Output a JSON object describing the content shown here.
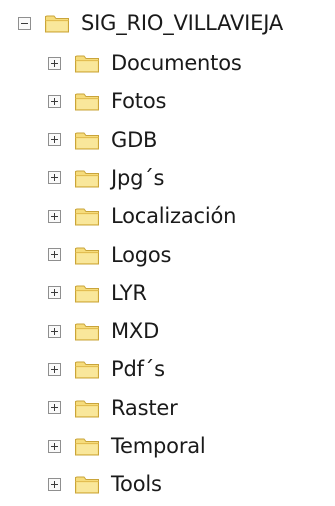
{
  "tree": {
    "root": {
      "label": "SIG_RIO_VILLAVIEJA",
      "expanded": true,
      "icon": "folder-icon"
    },
    "children": [
      {
        "label": "Documentos",
        "expanded": false,
        "icon": "folder-icon"
      },
      {
        "label": "Fotos",
        "expanded": false,
        "icon": "folder-icon"
      },
      {
        "label": "GDB",
        "expanded": false,
        "icon": "folder-icon"
      },
      {
        "label": "Jpg´s",
        "expanded": false,
        "icon": "folder-icon"
      },
      {
        "label": "Localización",
        "expanded": false,
        "icon": "folder-icon"
      },
      {
        "label": "Logos",
        "expanded": false,
        "icon": "folder-icon"
      },
      {
        "label": "LYR",
        "expanded": false,
        "icon": "folder-icon"
      },
      {
        "label": "MXD",
        "expanded": false,
        "icon": "folder-icon"
      },
      {
        "label": "Pdf´s",
        "expanded": false,
        "icon": "folder-icon"
      },
      {
        "label": "Raster",
        "expanded": false,
        "icon": "folder-icon"
      },
      {
        "label": "Temporal",
        "expanded": false,
        "icon": "folder-icon"
      },
      {
        "label": "Tools",
        "expanded": false,
        "icon": "folder-icon"
      }
    ]
  },
  "colors": {
    "folder_fill": "#f6dc7c",
    "folder_edge": "#c9a43a",
    "text": "#1a1a1a"
  }
}
